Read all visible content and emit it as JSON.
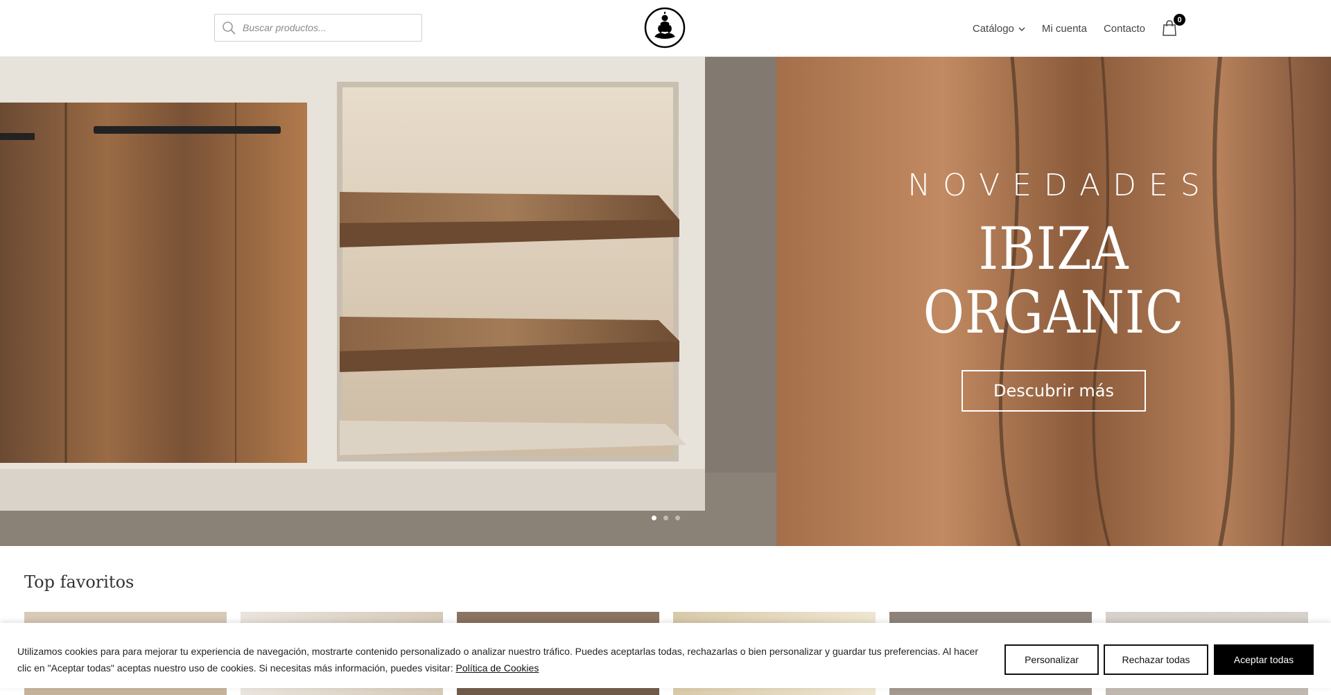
{
  "header": {
    "search_placeholder": "Buscar productos...",
    "nav": {
      "catalog": "Catálogo",
      "account": "Mi cuenta",
      "contact": "Contacto"
    },
    "cart_count": "0"
  },
  "hero": {
    "subtitle": "NOVEDADES",
    "title": "IBIZA ORGANIC",
    "button": "Descubrir más",
    "slides": 3,
    "active_slide": 1
  },
  "section": {
    "title": "Top favoritos"
  },
  "cookie": {
    "text": "Utilizamos cookies para para mejorar tu experiencia de navegación, mostrarte contenido personalizado o analizar nuestro tráfico. Puedes aceptarlas todas, rechazarlas o bien personalizar y guardar tus preferencias. Al hacer clic en \"Aceptar todas\" aceptas nuestro uso de cookies. Si necesitas más información, puedes visitar: ",
    "link": "Política de Cookies",
    "customize": "Personalizar",
    "reject": "Rechazar todas",
    "accept": "Aceptar todas"
  }
}
